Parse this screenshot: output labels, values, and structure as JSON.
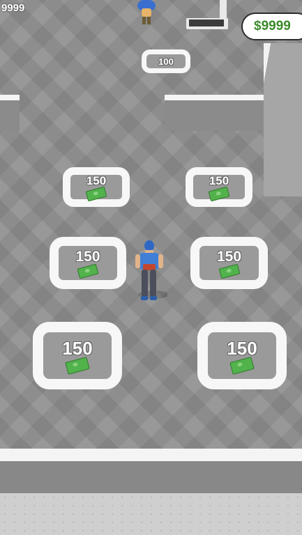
{
  "hud": {
    "fps_counter": "9999",
    "money": "$9999"
  },
  "pads": [
    {
      "price": "100",
      "icon": "cash-bill-icon"
    },
    {
      "price": "150",
      "icon": "cash-bill-icon"
    },
    {
      "price": "150",
      "icon": "cash-bill-icon"
    },
    {
      "price": "150",
      "icon": "cash-bill-icon"
    },
    {
      "price": "150",
      "icon": "cash-bill-icon"
    },
    {
      "price": "150",
      "icon": "cash-bill-icon"
    },
    {
      "price": "150",
      "icon": "cash-bill-icon"
    }
  ],
  "colors": {
    "money_text": "#3b8a2b",
    "cash_bill": "#52b24c",
    "player_shirt": "#3f7fd6",
    "floor": "#8e8e8e"
  }
}
